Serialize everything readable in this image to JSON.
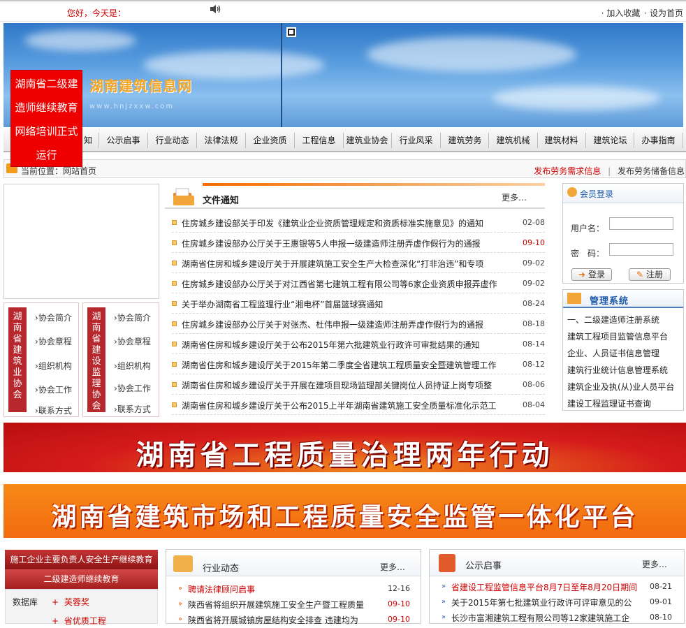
{
  "topbar": {
    "greeting": "您好，今天是：",
    "links": [
      "· 加入收藏",
      "· 设为首页"
    ]
  },
  "banner": {
    "logo_text": "湖南建筑信息网",
    "logo_sub": "www.hnjzxxw.com"
  },
  "popup": {
    "lines": [
      "湖南省二级建",
      "造师继续教育",
      "网络培训正式",
      "运行"
    ]
  },
  "nav": {
    "items": [
      "知",
      "公示启事",
      "行业动态",
      "法律法规",
      "企业资质",
      "工程信息",
      "建筑业协会",
      "行业风采",
      "建筑劳务",
      "建筑机械",
      "建筑材料",
      "建筑论坛",
      "办事指南"
    ]
  },
  "location": {
    "label": "当前位置：网站首页",
    "link1": "发布劳务需求信息",
    "sep": "|",
    "link2": "发布劳务储备信息"
  },
  "associations": [
    {
      "title": "湖南省建筑业协会",
      "links": [
        "协会简介",
        "协会章程",
        "组织机构",
        "协会工作",
        "联系方式"
      ]
    },
    {
      "title": "湖南省建设监理协会",
      "links": [
        "协会简介",
        "协会章程",
        "组织机构",
        "协会工作",
        "联系方式"
      ]
    }
  ],
  "notices": {
    "title": "文件通知",
    "more": "更多…",
    "highlight_color": "#cc0000",
    "items": [
      {
        "text": "住房城乡建设部关于印发《建筑业企业资质管理规定和资质标准实施意见》的通知",
        "date": "02-08",
        "hl": false
      },
      {
        "text": "住房城乡建设部办公厅关于王惠银等5人申报一级建造师注册弄虚作假行为的通报",
        "date": "09-10",
        "hl": true
      },
      {
        "text": "湖南省住房和城乡建设厅关于开展建筑施工安全生产大检查深化“打非治违”和专项",
        "date": "09-02",
        "hl": false
      },
      {
        "text": "住房城乡建设部办公厅关于对江西省第七建筑工程有限公司等6家企业资质申报弄虚作",
        "date": "09-02",
        "hl": false
      },
      {
        "text": "关于举办湖南省工程监理行业“湘电杯”首届篮球赛通知",
        "date": "08-24",
        "hl": false
      },
      {
        "text": "住房城乡建设部办公厅关于对张杰、杜伟申报一级建造师注册弄虚作假行为的通报",
        "date": "08-18",
        "hl": false
      },
      {
        "text": "湖南省住房和城乡建设厅关于公布2015年第六批建筑业行政许可审批结果的通知",
        "date": "08-14",
        "hl": false
      },
      {
        "text": "湖南省住房和城乡建设厅关于2015年第二季度全省建筑工程质量安全暨建筑管理工作",
        "date": "08-12",
        "hl": false
      },
      {
        "text": "湖南省住房和城乡建设厅关于开展在建项目现场监理部关键岗位人员持证上岗专项整",
        "date": "08-06",
        "hl": false
      },
      {
        "text": "湖南省住房和城乡建设厅关于公布2015上半年湖南省建筑施工安全质量标准化示范工",
        "date": "08-04",
        "hl": false
      }
    ]
  },
  "login": {
    "title": "会员登录",
    "username_label": "用户名：",
    "password_label": "密　码：",
    "login_btn": "登录",
    "register_btn": "注册"
  },
  "management": {
    "title": "管理系统",
    "links": [
      "一、二级建造师注册系统",
      "建筑工程项目监管信息平台",
      "企业、人员证书信息管理",
      "建筑行业统计信息管理系统",
      "建筑企业及执(从)业人员平台",
      "建设工程监理证书查询"
    ]
  },
  "banners": {
    "quality": "湖南省工程质量治理两年行动",
    "platform": "湖南省建筑市场和工程质量安全监管一体化平台"
  },
  "left_bottom": {
    "item1": "施工企业主要负责人安全生产继续教育",
    "item2": "二级建造师继续教育",
    "db_label": "数据库",
    "db_items": [
      "芙蓉奖",
      "省优质工程"
    ]
  },
  "industry": {
    "title": "行业动态",
    "more": "更多…",
    "items": [
      {
        "text": "聘请法律顾问启事",
        "date": "12-16",
        "red": true
      },
      {
        "text": "陕西省将组织开展建筑施工安全生产暨工程质量",
        "date": "09-10",
        "red": false
      },
      {
        "text": "陕西省将开展城镇房屋结构安全排查 违建均为",
        "date": "09-10",
        "red": false
      }
    ]
  },
  "announcements": {
    "title": "公示启事",
    "more": "更多…",
    "items": [
      {
        "text": "省建设工程监管信息平台8月7日至年8月20日期间",
        "date": "08-21",
        "red": true
      },
      {
        "text": "关于2015年第七批建筑业行政许可评审意见的公",
        "date": "09-01",
        "red": false
      },
      {
        "text": "长沙市富湘建筑工程有限公司等12家建筑施工企",
        "date": "08-10",
        "red": false
      }
    ]
  }
}
